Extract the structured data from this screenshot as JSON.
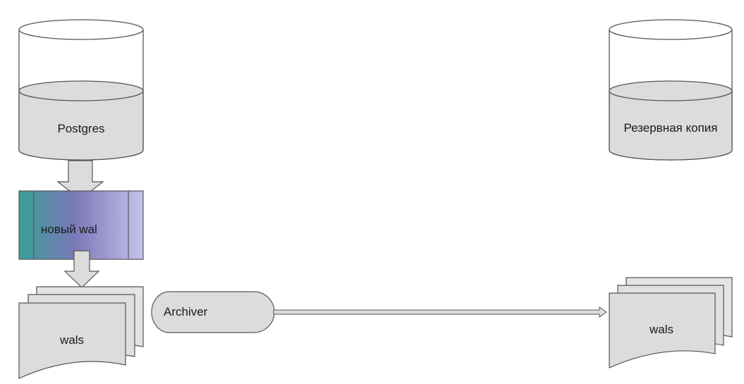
{
  "diagram": {
    "nodes": {
      "postgres": {
        "label": "Postgres",
        "shape": "cylinder"
      },
      "new_wal": {
        "label": "новый wal",
        "shape": "gradient-process"
      },
      "wals_left": {
        "label": "wals",
        "shape": "multi-document"
      },
      "archiver": {
        "label": "Archiver",
        "shape": "delay"
      },
      "backup": {
        "label": "Резервная копия",
        "shape": "cylinder"
      },
      "wals_right": {
        "label": "wals",
        "shape": "multi-document"
      }
    },
    "edges": [
      {
        "from": "postgres",
        "to": "new_wal",
        "style": "block-arrow"
      },
      {
        "from": "new_wal",
        "to": "wals_left",
        "style": "block-arrow"
      },
      {
        "from": "archiver",
        "to": "wals_right",
        "style": "line-arrow"
      }
    ],
    "colors": {
      "fill_gray": "#dcdcdc",
      "stroke": "#555555",
      "wal_gradient_start": "#3a9e96",
      "wal_gradient_mid": "#8882c0",
      "wal_gradient_end": "#c4c2ec",
      "background": "#ffffff"
    }
  }
}
